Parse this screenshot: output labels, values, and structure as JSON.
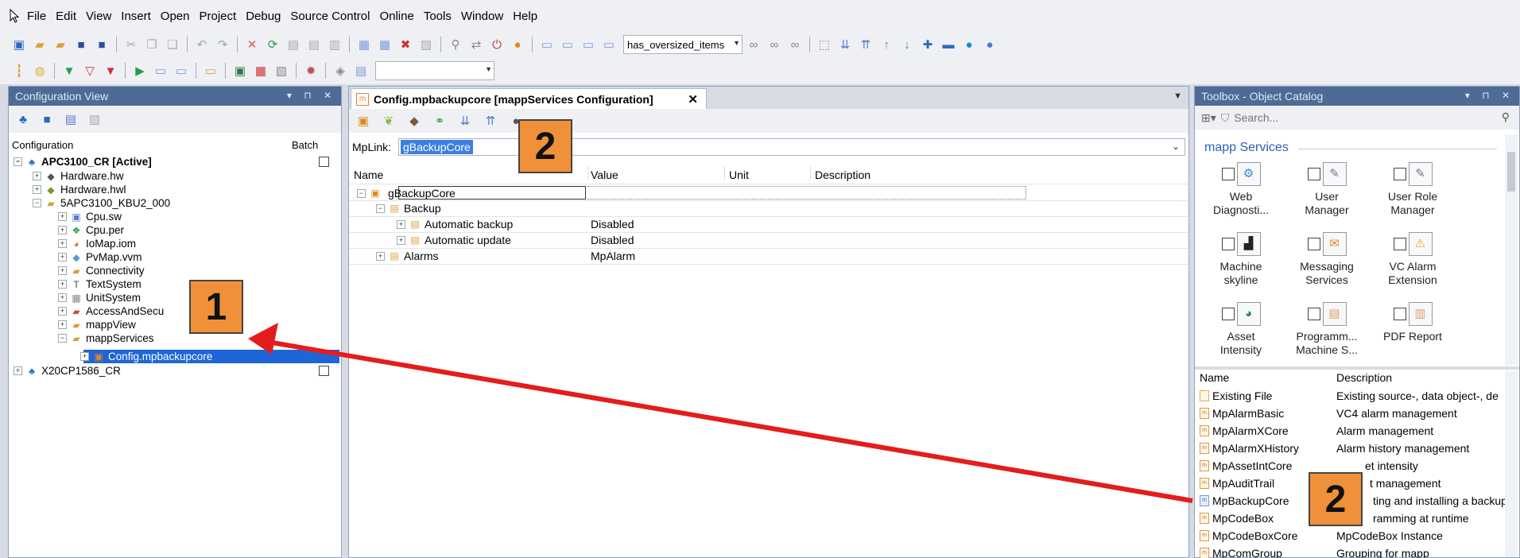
{
  "menu": [
    "File",
    "Edit",
    "View",
    "Insert",
    "Open",
    "Project",
    "Debug",
    "Source Control",
    "Online",
    "Tools",
    "Window",
    "Help"
  ],
  "toolbar": {
    "combo_value": "has_oversized_items",
    "combo2_value": ""
  },
  "left_pane": {
    "title": "Configuration View",
    "col_configuration": "Configuration",
    "col_batch": "Batch",
    "tree": [
      {
        "label": "APC3100_CR [Active]",
        "icon": "plc-icon"
      },
      {
        "label": "Hardware.hw",
        "icon": "hardware-icon"
      },
      {
        "label": "Hardware.hwl",
        "icon": "hardware-icon"
      },
      {
        "label": "5APC3100_KBU2_000",
        "icon": "folder-icon"
      },
      {
        "label": "Cpu.sw",
        "icon": "cpu-icon"
      },
      {
        "label": "Cpu.per",
        "icon": "permissions-icon"
      },
      {
        "label": "IoMap.iom",
        "icon": "iomap-icon"
      },
      {
        "label": "PvMap.vvm",
        "icon": "pvmap-icon"
      },
      {
        "label": "Connectivity",
        "icon": "folder-icon"
      },
      {
        "label": "TextSystem",
        "icon": "text-icon"
      },
      {
        "label": "UnitSystem",
        "icon": "unit-icon"
      },
      {
        "label": "AccessAndSecu",
        "icon": "folder-icon"
      },
      {
        "label": "mappView",
        "icon": "folder-icon"
      },
      {
        "label": "mappServices",
        "icon": "folder-icon"
      },
      {
        "label": "Config.mpbackupcore",
        "icon": "mapp-icon"
      },
      {
        "label": "X20CP1586_CR",
        "icon": "plc-icon"
      }
    ]
  },
  "editor": {
    "tab_title": "Config.mpbackupcore [mappServices Configuration]",
    "mplink_label": "MpLink:",
    "mplink_value": "gBackupCore",
    "columns": {
      "name": "Name",
      "value": "Value",
      "unit": "Unit",
      "description": "Description"
    },
    "rows": [
      {
        "name": "gBackupCore",
        "value": ""
      },
      {
        "name": "Backup",
        "value": ""
      },
      {
        "name": "Automatic backup",
        "value": "Disabled"
      },
      {
        "name": "Automatic update",
        "value": "Disabled"
      },
      {
        "name": "Alarms",
        "value": "MpAlarm"
      }
    ]
  },
  "right_pane": {
    "title": "Toolbox - Object Catalog",
    "search_placeholder": "Search...",
    "group": "mapp Services",
    "catalog": [
      {
        "line1": "Web",
        "line2": "Diagnosti...",
        "icon": "web-diagnostics-icon"
      },
      {
        "line1": "User",
        "line2": "Manager",
        "icon": "user-manager-icon"
      },
      {
        "line1": "User Role",
        "line2": "Manager",
        "icon": "user-role-icon"
      },
      {
        "line1": "Machine",
        "line2": "skyline",
        "icon": "skyline-icon"
      },
      {
        "line1": "Messaging",
        "line2": "Services",
        "icon": "messaging-icon"
      },
      {
        "line1": "VC Alarm",
        "line2": "Extension",
        "icon": "alarm-icon"
      },
      {
        "line1": "Asset",
        "line2": "Intensity",
        "icon": "asset-icon"
      },
      {
        "line1": "Programm...",
        "line2": "Machine S...",
        "icon": "program-icon"
      },
      {
        "line1": "PDF Report",
        "line2": "",
        "icon": "pdf-icon"
      }
    ],
    "list_col_name": "Name",
    "list_col_desc": "Description",
    "list": [
      {
        "name": "Existing File",
        "desc": "Existing source-, data object-, de"
      },
      {
        "name": "MpAlarmBasic",
        "desc": "VC4 alarm management"
      },
      {
        "name": "MpAlarmXCore",
        "desc": "Alarm management"
      },
      {
        "name": "MpAlarmXHistory",
        "desc": "Alarm history management"
      },
      {
        "name": "MpAssetIntCore",
        "desc": "et intensity"
      },
      {
        "name": "MpAuditTrail",
        "desc": "t management"
      },
      {
        "name": "MpBackupCore",
        "desc": "ting and installing a backup"
      },
      {
        "name": "MpCodeBox",
        "desc": "ramming at runtime"
      },
      {
        "name": "MpCodeBoxCore",
        "desc": "MpCodeBox Instance"
      },
      {
        "name": "MpComGroup",
        "desc": "Grouping for mapp"
      }
    ]
  },
  "markers": {
    "m1": "1",
    "m2a": "2",
    "m2b": "2"
  },
  "colors": {
    "accent": "#4d6b95",
    "marker": "#f0913a",
    "arrow": "#e51c1c",
    "selection": "#1e66d8"
  }
}
